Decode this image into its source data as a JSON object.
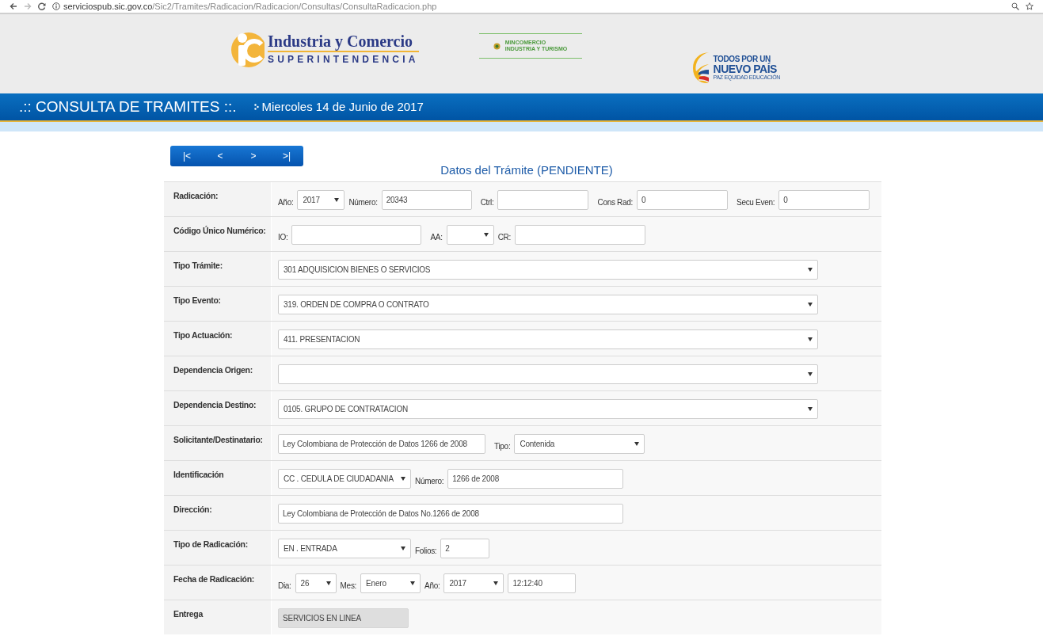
{
  "browser": {
    "url_host": "serviciospub.sic.gov.co",
    "url_path": "/Sic2/Tramites/Radicacion/Radicacion/Consultas/ConsultaRadicacion.php"
  },
  "header": {
    "logo_title": "Industria y Comercio",
    "logo_subtitle": "SUPERINTENDENCIA",
    "ministry_line_1": "MINCOMERCIO",
    "ministry_line_2": "INDUSTRIA Y TURISMO",
    "slogan_line_1": "TODOS POR UN",
    "slogan_line_2": "NUEVO PAÍS",
    "slogan_line_3": "PAZ  EQUIDAD  EDUCACIÓN"
  },
  "title_bar": {
    "title": ".:: CONSULTA DE TRAMITES ::.",
    "date": "Miercoles 14 de Junio de 2017"
  },
  "pager": [
    "|<",
    "<",
    ">",
    ">|"
  ],
  "form_title": "Datos del Trámite (PENDIENTE)",
  "rows": [
    {
      "label": "Radicación:",
      "controls": [
        {
          "kind": "label",
          "text": "Año:"
        },
        {
          "kind": "select",
          "value": "2017"
        },
        {
          "kind": "label",
          "text": "Número:"
        },
        {
          "kind": "input",
          "value": "20343"
        },
        {
          "kind": "label",
          "text": "Ctrl:"
        },
        {
          "kind": "input"
        },
        {
          "kind": "label",
          "text": "Cons Rad:"
        },
        {
          "kind": "input",
          "value": "0"
        },
        {
          "kind": "label",
          "text": "Secu Even:"
        },
        {
          "kind": "input",
          "value": "0"
        }
      ]
    },
    {
      "label": "Código Único Numérico:",
      "controls": [
        {
          "kind": "label",
          "text": "IO:"
        },
        {
          "kind": "input"
        },
        {
          "kind": "label",
          "text": "AA:"
        },
        {
          "kind": "select"
        },
        {
          "kind": "label",
          "text": "CR:"
        },
        {
          "kind": "input"
        }
      ]
    },
    {
      "label": "Tipo Trámite:",
      "controls": [
        {
          "kind": "select",
          "value": "301  ADQUISICION BIENES O SERVICIOS"
        }
      ]
    },
    {
      "label": "Tipo Evento:",
      "controls": [
        {
          "kind": "select",
          "value": "319. ORDEN DE COMPRA O CONTRATO"
        }
      ]
    },
    {
      "label": "Tipo Actuación:",
      "controls": [
        {
          "kind": "select",
          "value": "411. PRESENTACION"
        }
      ]
    },
    {
      "label": "Dependencia Origen:",
      "controls": [
        {
          "kind": "select"
        }
      ]
    },
    {
      "label": "Dependencia Destino:",
      "controls": [
        {
          "kind": "select",
          "value": "0105. GRUPO DE CONTRATACION"
        }
      ]
    },
    {
      "label": "Solicitante/Destinatario:",
      "controls": [
        {
          "kind": "input",
          "value": "Ley Colombiana de Protección de Datos 1266 de 2008"
        },
        {
          "kind": "label",
          "text": "Tipo:"
        },
        {
          "kind": "select",
          "value": "Contenida"
        }
      ]
    },
    {
      "label": "Identificación",
      "controls": [
        {
          "kind": "select",
          "value": "CC . CEDULA DE CIUDADANIA"
        },
        {
          "kind": "label",
          "text": "Número:"
        },
        {
          "kind": "input",
          "value": "1266 de 2008"
        }
      ]
    },
    {
      "label": "Dirección:",
      "controls": [
        {
          "kind": "input",
          "value": "Ley Colombiana de Protección de Datos No.1266 de 2008"
        }
      ]
    },
    {
      "label": "Tipo de Radicación:",
      "controls": [
        {
          "kind": "select",
          "value": "EN . ENTRADA"
        },
        {
          "kind": "label",
          "text": "Folios:"
        },
        {
          "kind": "input",
          "value": "2"
        }
      ]
    },
    {
      "label": "Fecha de Radicación:",
      "controls": [
        {
          "kind": "label",
          "text": "Dia:"
        },
        {
          "kind": "select",
          "value": "26"
        },
        {
          "kind": "label",
          "text": "Mes:"
        },
        {
          "kind": "select",
          "value": "Enero"
        },
        {
          "kind": "label",
          "text": "Año:"
        },
        {
          "kind": "select",
          "value": "2017"
        },
        {
          "kind": "input",
          "value": "12:12:40"
        }
      ]
    },
    {
      "label": "Entrega",
      "controls": [
        {
          "kind": "readonly",
          "value": "SERVICIOS EN LINEA"
        }
      ]
    }
  ]
}
